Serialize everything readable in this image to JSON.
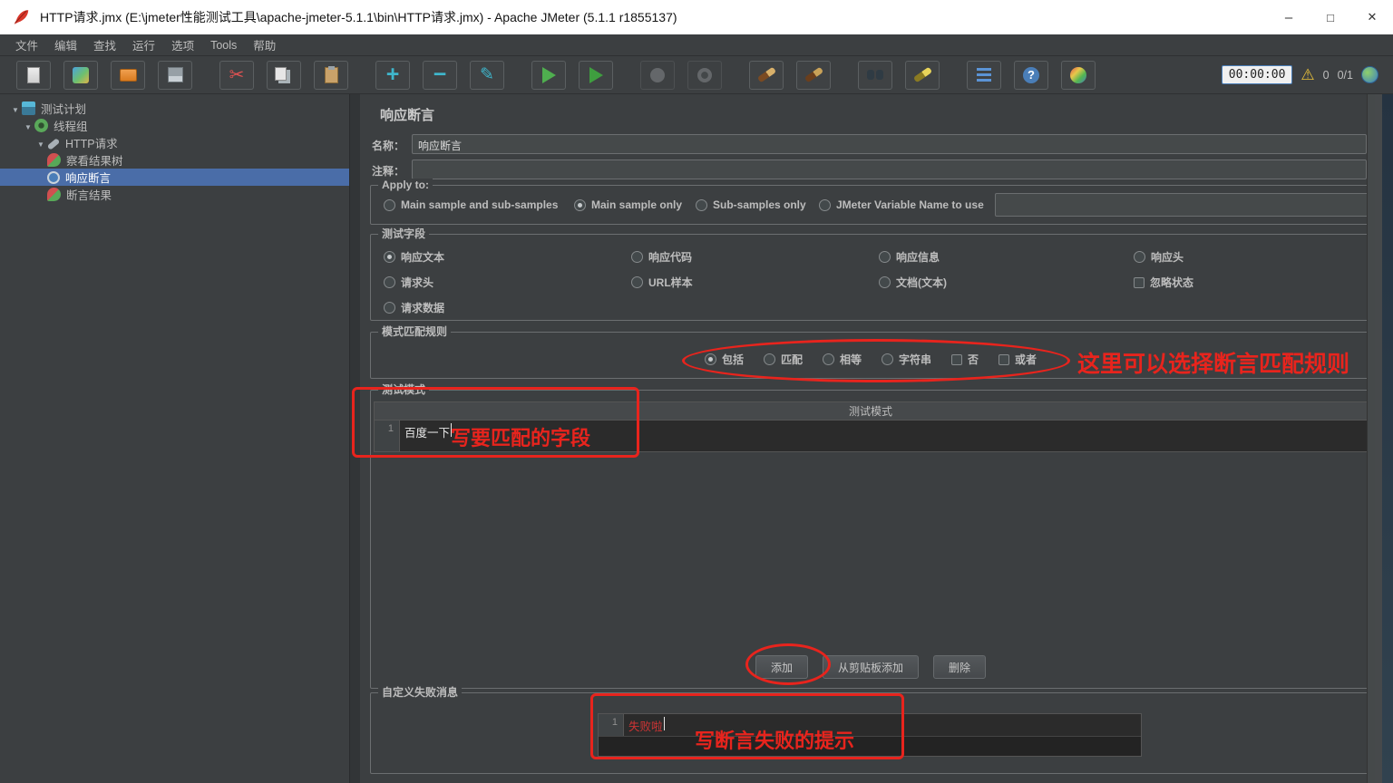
{
  "window": {
    "title": "HTTP请求.jmx (E:\\jmeter性能测试工具\\apache-jmeter-5.1.1\\bin\\HTTP请求.jmx) - Apache JMeter (5.1.1 r1855137)"
  },
  "menubar": {
    "items": [
      "文件",
      "编辑",
      "查找",
      "运行",
      "选项",
      "Tools",
      "帮助"
    ]
  },
  "toolbar": {
    "timer": "00:00:00",
    "error_count": "0",
    "threads": "0/1"
  },
  "tree": {
    "items": [
      {
        "label": "测试计划"
      },
      {
        "label": "线程组"
      },
      {
        "label": "HTTP请求"
      },
      {
        "label": "察看结果树"
      },
      {
        "label": "响应断言"
      },
      {
        "label": "断言结果"
      }
    ]
  },
  "panel": {
    "title": "响应断言",
    "name": {
      "label": "名称：",
      "value": "响应断言"
    },
    "comment": {
      "label": "注释：",
      "value": ""
    },
    "apply_to": {
      "legend": "Apply to:",
      "options": [
        "Main sample and sub-samples",
        "Main sample only",
        "Sub-samples only",
        "JMeter Variable Name to use"
      ]
    },
    "test_field": {
      "legend": "测试字段",
      "options": [
        "响应文本",
        "响应代码",
        "响应信息",
        "响应头",
        "请求头",
        "URL样本",
        "文档(文本)",
        "忽略状态",
        "请求数据"
      ]
    },
    "pattern_rules": {
      "legend": "模式匹配规则",
      "options": [
        "包括",
        "匹配",
        "相等",
        "字符串",
        "否",
        "或者"
      ]
    },
    "patterns": {
      "legend": "测试模式",
      "header": "测试模式",
      "row_index": "1",
      "row_value": "百度一下"
    },
    "buttons": {
      "add": "添加",
      "add_from_clipboard": "从剪贴板添加",
      "delete": "删除"
    },
    "failure": {
      "legend": "自定义失败消息",
      "row_index": "1",
      "row_value": "失败啦"
    }
  },
  "annotations": {
    "rules_note": "这里可以选择断言匹配规则",
    "pattern_note": "写要匹配的字段",
    "failure_note": "写断言失败的提示"
  }
}
